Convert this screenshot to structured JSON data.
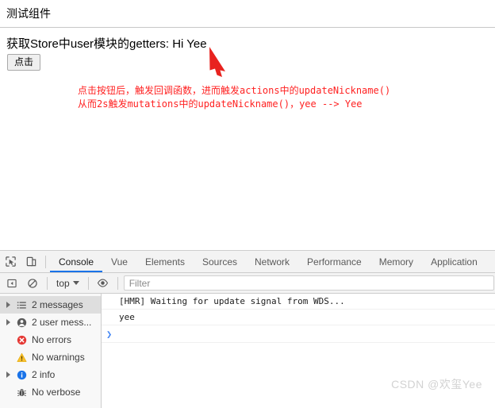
{
  "page": {
    "title": "测试组件",
    "getter_text": "获取Store中user模块的getters: Hi Yee",
    "button_label": "点击",
    "annotation_line1": "点击按钮后，触发回调函数，进而触发actions中的updateNickname()",
    "annotation_line2": "从而2s触发mutations中的updateNickname()，yee --> Yee",
    "annotation_color": "#ff2222",
    "arrow_color": "#e8231f"
  },
  "devtools": {
    "toolbar_icons": [
      {
        "name": "inspect-element-icon",
        "title": "Inspect element"
      },
      {
        "name": "device-toolbar-icon",
        "title": "Toggle device toolbar"
      }
    ],
    "tabs": [
      {
        "label": "Console",
        "active": true
      },
      {
        "label": "Vue",
        "active": false
      },
      {
        "label": "Elements",
        "active": false
      },
      {
        "label": "Sources",
        "active": false
      },
      {
        "label": "Network",
        "active": false
      },
      {
        "label": "Performance",
        "active": false
      },
      {
        "label": "Memory",
        "active": false
      },
      {
        "label": "Application",
        "active": false
      }
    ],
    "active_tab_underline_color": "#1a73e8",
    "filterbar": {
      "sidebar_toggle_icon": "sidebar-toggle-icon",
      "clear_console_icon": "clear-console-icon",
      "context_value": "top",
      "eye_icon": "eye-icon",
      "filter_placeholder": "Filter",
      "filter_value": ""
    },
    "sidebar": [
      {
        "label": "2 messages",
        "icon": "list-icon",
        "expandable": true,
        "selected": true
      },
      {
        "label": "2 user mess...",
        "icon": "person-icon",
        "expandable": true,
        "selected": false
      },
      {
        "label": "No errors",
        "icon": "error-icon",
        "expandable": false,
        "selected": false
      },
      {
        "label": "No warnings",
        "icon": "warning-icon",
        "expandable": false,
        "selected": false
      },
      {
        "label": "2 info",
        "icon": "info-icon",
        "expandable": true,
        "selected": false
      },
      {
        "label": "No verbose",
        "icon": "bug-icon",
        "expandable": false,
        "selected": false
      }
    ],
    "console_messages": [
      {
        "text": "[HMR] Waiting for update signal from WDS..."
      },
      {
        "text": "yee"
      }
    ],
    "prompt_symbol": "❯"
  },
  "watermark": "CSDN @欢玺Yee"
}
